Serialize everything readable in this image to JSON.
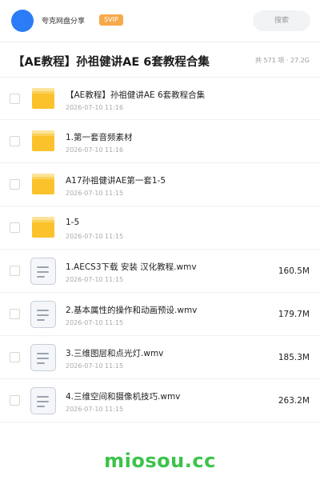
{
  "header": {
    "share_name": "夸克网盘分享",
    "badge": "SVIP",
    "search_label": "搜索",
    "avatar_color": "#2b7cf6",
    "badge_color": "#f7a94a"
  },
  "title": {
    "text": "【AE教程】孙祖健讲AE 6套教程合集",
    "meta": "共 571 项 · 27.2G"
  },
  "files": [
    {
      "type": "folder",
      "icon": "folder-icon",
      "name": "【AE教程】孙祖健讲AE 6套教程合集",
      "date": "2026-07-10 11:16",
      "size": ""
    },
    {
      "type": "folder",
      "icon": "folder-icon",
      "name": "1.第一套音频素材",
      "date": "2026-07-10 11:16",
      "size": ""
    },
    {
      "type": "folder",
      "icon": "folder-icon",
      "name": "A17孙祖健讲AE第一套1-5",
      "date": "2026-07-10 11:15",
      "size": ""
    },
    {
      "type": "folder",
      "icon": "folder-icon",
      "name": "1-5",
      "date": "2026-07-10 11:15",
      "size": ""
    },
    {
      "type": "file",
      "icon": "document-icon",
      "name": "1.AECS3下载 安装 汉化教程.wmv",
      "date": "2026-07-10 11:15",
      "size": "160.5M"
    },
    {
      "type": "file",
      "icon": "document-icon",
      "name": "2.基本属性的操作和动画预设.wmv",
      "date": "2026-07-10 11:15",
      "size": "179.7M"
    },
    {
      "type": "file",
      "icon": "document-icon",
      "name": "3.三维图层和点光灯.wmv",
      "date": "2026-07-10 11:15",
      "size": "185.3M"
    },
    {
      "type": "file",
      "icon": "document-icon",
      "name": "4.三维空间和摄像机技巧.wmv",
      "date": "2026-07-10 11:15",
      "size": "263.2M"
    }
  ],
  "watermark": "miosou.cc"
}
